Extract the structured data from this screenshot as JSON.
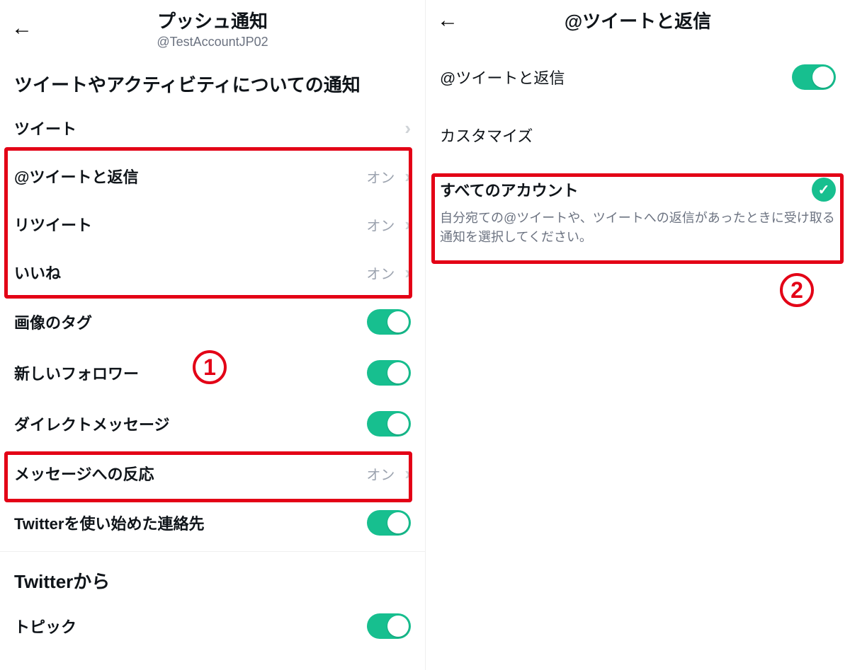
{
  "left": {
    "header": {
      "title": "プッシュ通知",
      "subtitle": "@TestAccountJP02"
    },
    "section1_title": "ツイートやアクティビティについての通知",
    "rows": {
      "tweets": {
        "label": "ツイート"
      },
      "mentions": {
        "label": "@ツイートと返信",
        "value": "オン"
      },
      "retweets": {
        "label": "リツイート",
        "value": "オン"
      },
      "likes": {
        "label": "いいね",
        "value": "オン"
      },
      "photo_tags": {
        "label": "画像のタグ"
      },
      "new_follower": {
        "label": "新しいフォロワー"
      },
      "dm": {
        "label": "ダイレクトメッセージ"
      },
      "msg_react": {
        "label": "メッセージへの反応",
        "value": "オン"
      },
      "contacts": {
        "label": "Twitterを使い始めた連絡先"
      }
    },
    "section2_title": "Twitterから",
    "rows2": {
      "topic": {
        "label": "トピック"
      }
    },
    "badge1": "1"
  },
  "right": {
    "header": {
      "title": "@ツイートと返信"
    },
    "toggle_row": {
      "label": "@ツイートと返信"
    },
    "customize_title": "カスタマイズ",
    "all_accounts": {
      "label": "すべてのアカウント",
      "sub": "自分宛ての@ツイートや、ツイートへの返信があったときに受け取る通知を選択してください。"
    },
    "badge2": "2"
  }
}
